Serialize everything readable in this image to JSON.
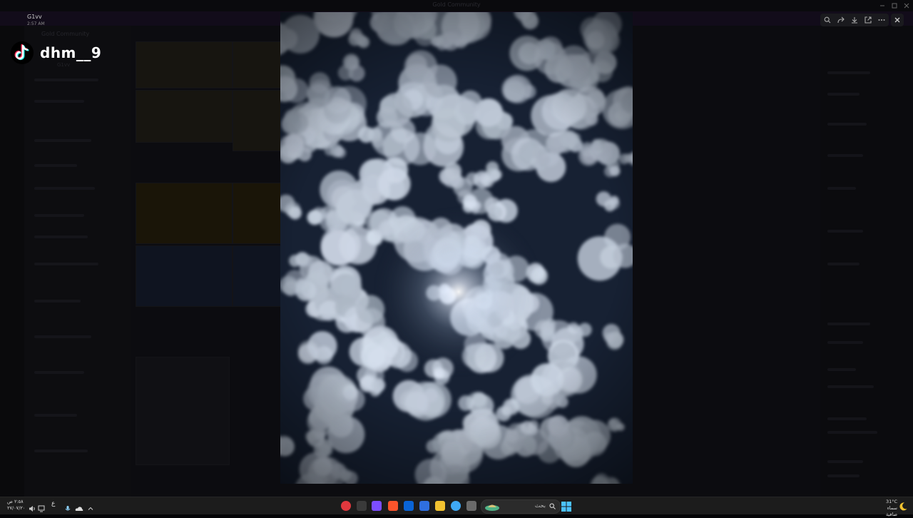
{
  "background_app": {
    "title": "Gold Community"
  },
  "viewer": {
    "channel": "G1vv",
    "time": "2:57 AM",
    "watermark": "dhm__9",
    "tools": [
      "zoom-icon",
      "forward-icon",
      "download-icon",
      "open-external-icon",
      "more-icon"
    ],
    "close": "close-icon"
  },
  "taskbar": {
    "search_placeholder": "بحث",
    "clock_time": "٢:٥٨ ص",
    "clock_date": "٢٧/٠٧/٢٠",
    "weather_temp": "31°C",
    "weather_desc": "سماء صافية",
    "lang": "ع"
  },
  "colors": {
    "accent": "#5865f2",
    "sky": "#172133",
    "cloud": "#c9d4e0"
  }
}
